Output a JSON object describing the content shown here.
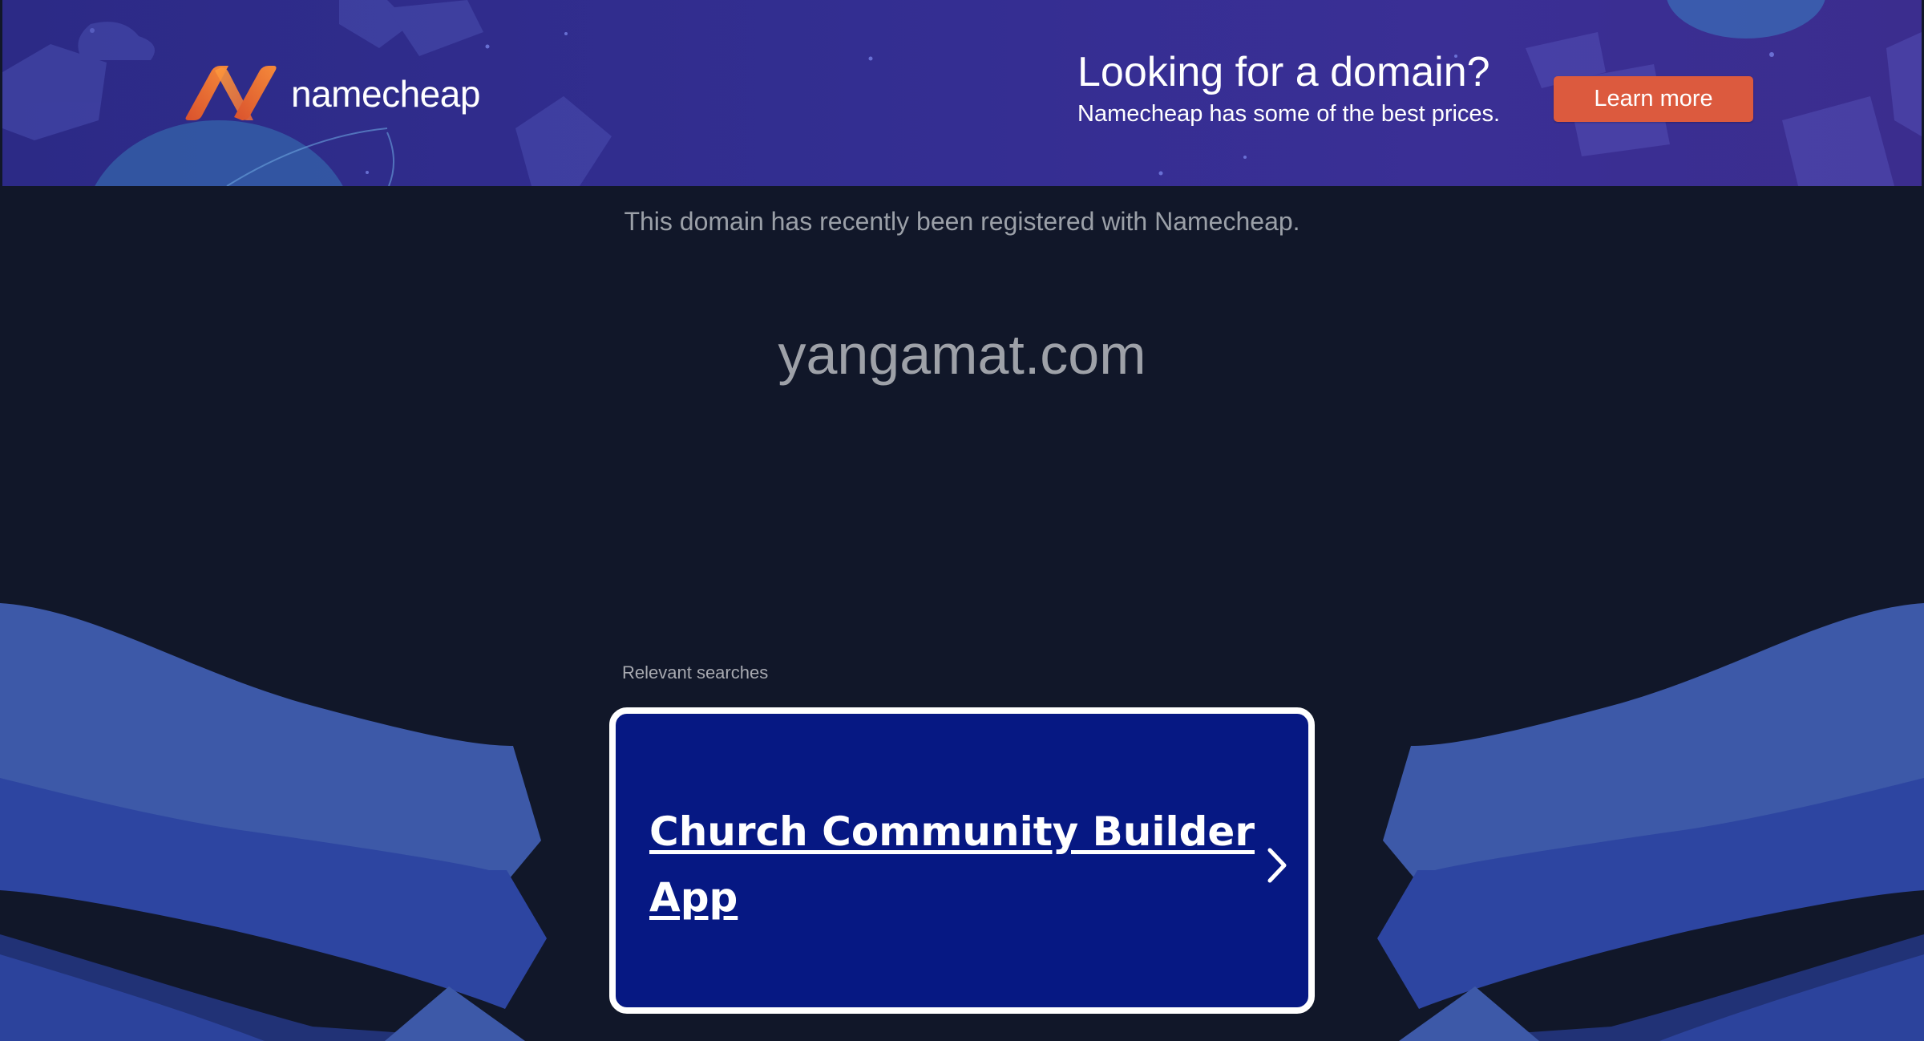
{
  "banner": {
    "logo_text": "namecheap",
    "headline": "Looking for a domain?",
    "subline": "Namecheap has some of the best prices.",
    "cta_label": "Learn more"
  },
  "notice": "This domain has recently been registered with Namecheap.",
  "domain_name": "yangamat.com",
  "relevant_searches": {
    "label": "Relevant searches",
    "items": [
      {
        "label": "Church Community Builder App",
        "icon": "chevron-right-icon"
      }
    ]
  },
  "colors": {
    "page_bg": "#111729",
    "banner_bg": "#332e91",
    "cta_bg": "#dc5a3e",
    "card_bg": "#061883",
    "wave_light": "#3d59a8",
    "wave_mid": "#2d45a1",
    "wave_dark": "#213276"
  }
}
